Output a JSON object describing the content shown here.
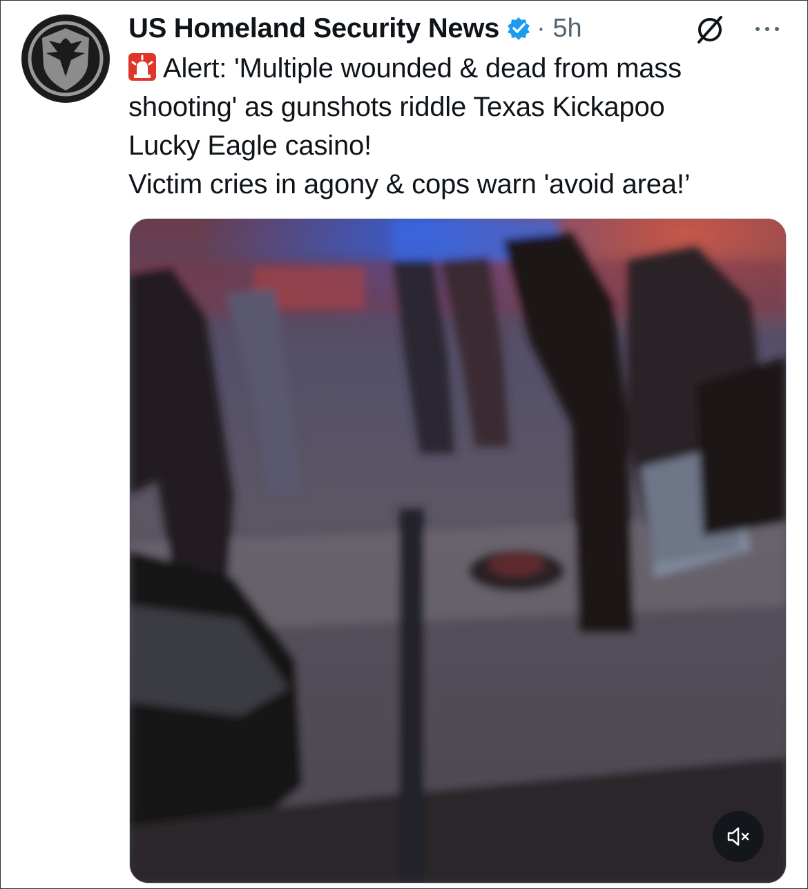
{
  "tweet": {
    "author_name": "US Homeland Security News",
    "separator_time": "· 5h",
    "text_lines": [
      "Alert: 'Multiple wounded & dead from mass",
      "shooting' as gunshots riddle Texas Kickapoo",
      "Lucky Eagle casino!",
      "Victim cries in agony & cops warn 'avoid area!’"
    ]
  },
  "icons": {
    "avatar": "shield-eagle-logo",
    "verified": "verified-badge-icon",
    "grok": "grok-icon",
    "more": "more-icon",
    "siren": "siren-icon",
    "mute": "muted-speaker-icon"
  },
  "colors": {
    "verified_blue": "#1d9bf0",
    "text": "#0f1419",
    "muted": "#536471",
    "siren_red": "#e0352b"
  }
}
